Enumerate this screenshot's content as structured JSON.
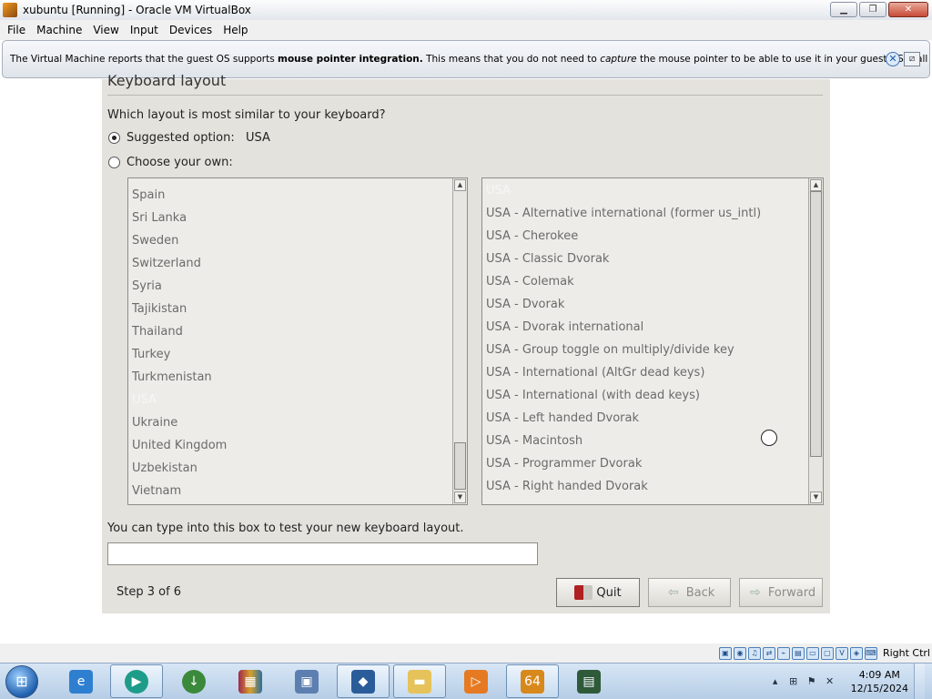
{
  "window": {
    "title": "xubuntu [Running] - Oracle VM VirtualBox"
  },
  "menu": [
    "File",
    "Machine",
    "View",
    "Input",
    "Devices",
    "Help"
  ],
  "notice": {
    "part1": "The Virtual Machine reports that the guest OS supports ",
    "bold": "mouse pointer integration.",
    "part2": " This means that you do not need to ",
    "italic": "capture",
    "part3": " the mouse pointer to be able to use it in your guest OS -- all mouse"
  },
  "installer": {
    "section_title": "Keyboard layout",
    "question": "Which layout is most similar to your keyboard?",
    "suggested_label": "Suggested option:",
    "suggested_value": "USA",
    "choose_label": "Choose your own:",
    "countries": [
      "Spain",
      "Sri Lanka",
      "Sweden",
      "Switzerland",
      "Syria",
      "Tajikistan",
      "Thailand",
      "Turkey",
      "Turkmenistan",
      "USA",
      "Ukraine",
      "United Kingdom",
      "Uzbekistan",
      "Vietnam"
    ],
    "selected_country": "USA",
    "variants": [
      "USA",
      "USA - Alternative international (former us_intl)",
      "USA - Cherokee",
      "USA - Classic Dvorak",
      "USA - Colemak",
      "USA - Dvorak",
      "USA - Dvorak international",
      "USA - Group toggle on multiply/divide key",
      "USA - International (AltGr dead keys)",
      "USA - International (with dead keys)",
      "USA - Left handed Dvorak",
      "USA - Macintosh",
      "USA - Programmer Dvorak",
      "USA - Right handed Dvorak"
    ],
    "selected_variant": "USA",
    "test_label": "You can type into this box to test your new keyboard layout.",
    "test_value": "",
    "step": "Step 3 of 6",
    "buttons": {
      "quit": "Quit",
      "back": "Back",
      "forward": "Forward"
    }
  },
  "statusbar": {
    "host_key": "Right Ctrl"
  },
  "taskbar": {
    "apps": [
      "Internet Explorer",
      "Media",
      "Download Manager",
      "WinRAR",
      "Setup",
      "VirtualBox",
      "Windows Explorer",
      "Media Player",
      "VirtualBox VM",
      "Console"
    ],
    "clock": {
      "time": "4:09 AM",
      "date": "12/15/2024"
    }
  }
}
